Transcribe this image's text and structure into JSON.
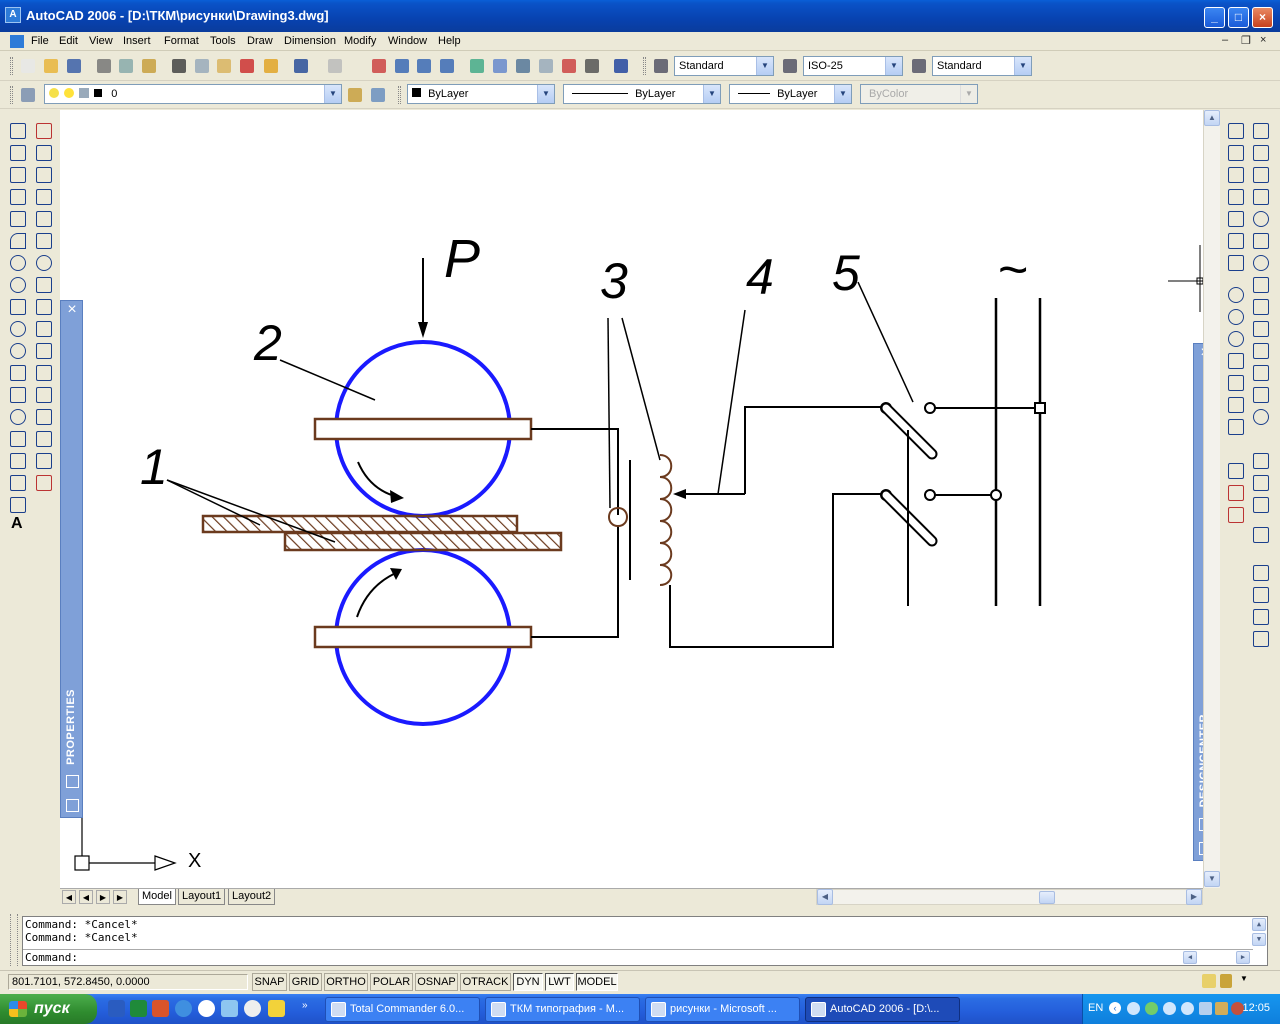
{
  "window": {
    "title": "AutoCAD 2006 - [D:\\ТКМ\\рисунки\\Drawing3.dwg]",
    "app_icon": "autocad-icon",
    "controls": {
      "minimize": "_",
      "maximize": "□",
      "close": "×"
    },
    "mdi_controls": {
      "minimize": "–",
      "restore": "❐",
      "close": "×"
    }
  },
  "menu": [
    "File",
    "Edit",
    "View",
    "Insert",
    "Format",
    "Tools",
    "Draw",
    "Dimension",
    "Modify",
    "Window",
    "Help"
  ],
  "styles_toolbar": {
    "text_style": "Standard",
    "dim_style": "ISO-25",
    "table_style": "Standard"
  },
  "layers_toolbar": {
    "layer": "0",
    "color": "ByLayer",
    "linetype": "ByLayer",
    "lineweight": "ByLayer",
    "plotstyle": "ByColor"
  },
  "drawing": {
    "label_P": "P",
    "label_1": "1",
    "label_2": "2",
    "label_3": "3",
    "label_4": "4",
    "label_5": "5",
    "ac_symbol": "~",
    "ucs_x": "X",
    "colors": {
      "rollers": "#1a1aff",
      "electrodes": "#6b3a1e",
      "wires": "#000000"
    }
  },
  "palettes": {
    "properties": "PROPERTIES",
    "designcenter": "DESIGNCENTER"
  },
  "tabs": [
    "Model",
    "Layout1",
    "Layout2"
  ],
  "command": {
    "history": [
      "Command: *Cancel*",
      "Command: *Cancel*"
    ],
    "prompt": "Command:"
  },
  "status": {
    "coords": "801.7101, 572.8450, 0.0000",
    "buttons": [
      "SNAP",
      "GRID",
      "ORTHO",
      "POLAR",
      "OSNAP",
      "OTRACK",
      "DYN",
      "LWT",
      "MODEL"
    ],
    "active": [
      "DYN",
      "LWT",
      "MODEL"
    ]
  },
  "taskbar": {
    "start": "пуск",
    "tasks": [
      "Total Commander 6.0...",
      "ТКМ типография - М...",
      "рисунки - Microsoft ...",
      "AutoCAD 2006 - [D:\\..."
    ],
    "active_task": 3,
    "lang": "EN",
    "clock": "12:05"
  }
}
